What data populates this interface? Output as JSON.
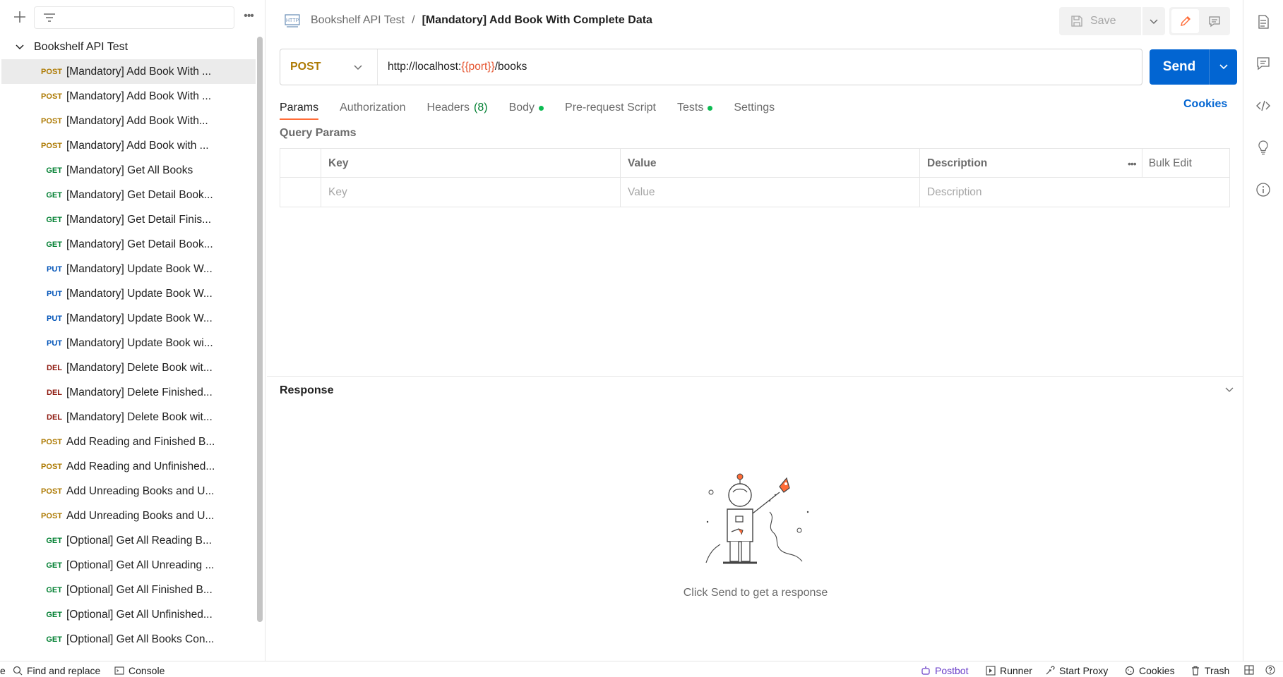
{
  "sidebar": {
    "collection": "Bookshelf API Test",
    "requests": [
      {
        "method": "POST",
        "name": "[Mandatory] Add Book With ..."
      },
      {
        "method": "POST",
        "name": "[Mandatory] Add Book With ..."
      },
      {
        "method": "POST",
        "name": "[Mandatory] Add Book With..."
      },
      {
        "method": "POST",
        "name": "[Mandatory] Add Book with ..."
      },
      {
        "method": "GET",
        "name": "[Mandatory] Get All Books"
      },
      {
        "method": "GET",
        "name": "[Mandatory] Get Detail Book..."
      },
      {
        "method": "GET",
        "name": "[Mandatory] Get Detail Finis..."
      },
      {
        "method": "GET",
        "name": "[Mandatory] Get Detail Book..."
      },
      {
        "method": "PUT",
        "name": "[Mandatory] Update Book W..."
      },
      {
        "method": "PUT",
        "name": "[Mandatory] Update Book W..."
      },
      {
        "method": "PUT",
        "name": "[Mandatory] Update Book W..."
      },
      {
        "method": "PUT",
        "name": "[Mandatory] Update Book wi..."
      },
      {
        "method": "DEL",
        "name": "[Mandatory] Delete Book wit..."
      },
      {
        "method": "DEL",
        "name": "[Mandatory] Delete Finished..."
      },
      {
        "method": "DEL",
        "name": "[Mandatory] Delete Book wit..."
      },
      {
        "method": "POST",
        "name": "Add Reading and Finished B..."
      },
      {
        "method": "POST",
        "name": "Add Reading and Unfinished..."
      },
      {
        "method": "POST",
        "name": "Add Unreading Books and U..."
      },
      {
        "method": "POST",
        "name": "Add Unreading Books and U..."
      },
      {
        "method": "GET",
        "name": "[Optional] Get All Reading B..."
      },
      {
        "method": "GET",
        "name": "[Optional] Get All Unreading ..."
      },
      {
        "method": "GET",
        "name": "[Optional] Get All Finished B..."
      },
      {
        "method": "GET",
        "name": "[Optional] Get All Unfinished..."
      },
      {
        "method": "GET",
        "name": "[Optional] Get All Books Con..."
      }
    ]
  },
  "header": {
    "breadcrumb_parent": "Bookshelf API Test",
    "breadcrumb_sep": "/",
    "title": "[Mandatory] Add Book With Complete Data",
    "save_label": "Save",
    "http_icon_text": "HTTP"
  },
  "request": {
    "method": "POST",
    "url_prefix": "http://localhost:",
    "url_var": "{{port}}",
    "url_suffix": "/books",
    "send_label": "Send"
  },
  "tabs": {
    "params": "Params",
    "authorization": "Authorization",
    "headers": "Headers",
    "headers_count": "(8)",
    "body": "Body",
    "prerequest": "Pre-request Script",
    "tests": "Tests",
    "settings": "Settings",
    "cookies": "Cookies"
  },
  "params": {
    "title": "Query Params",
    "col_key": "Key",
    "col_value": "Value",
    "col_description": "Description",
    "bulk_edit": "Bulk Edit",
    "ph_key": "Key",
    "ph_value": "Value",
    "ph_description": "Description"
  },
  "response": {
    "title": "Response",
    "empty_text": "Click Send to get a response"
  },
  "footer": {
    "left_stub": "e",
    "find_replace": "Find and replace",
    "console": "Console",
    "postbot": "Postbot",
    "runner": "Runner",
    "start_proxy": "Start Proxy",
    "cookies": "Cookies",
    "trash": "Trash"
  },
  "colors": {
    "accent": "#ff6c37",
    "send_blue": "#0265d2",
    "post": "#ad7a03",
    "get": "#007f31",
    "put": "#0053b8",
    "del": "#8e1a10"
  }
}
